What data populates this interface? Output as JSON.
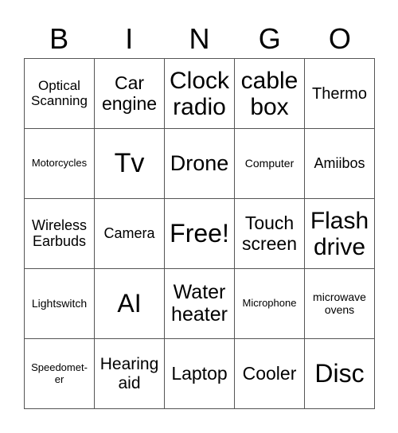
{
  "header": {
    "letters": [
      "B",
      "I",
      "N",
      "G",
      "O"
    ]
  },
  "grid": {
    "rows": [
      [
        "Optical Scanning",
        "Car engine",
        "Clock radio",
        "cable box",
        "Thermo"
      ],
      [
        "Motorcycles",
        "Tv",
        "Drone",
        "Computer",
        "Amiibos"
      ],
      [
        "Wireless Earbuds",
        "Camera",
        "Free!",
        "Touch screen",
        "Flash drive"
      ],
      [
        "Lightswitch",
        "AI",
        "Water heater",
        "Microphone",
        "microwave ovens"
      ],
      [
        "Speedomet-er",
        "Hearing aid",
        "Laptop",
        "Cooler",
        "Disc"
      ]
    ]
  }
}
